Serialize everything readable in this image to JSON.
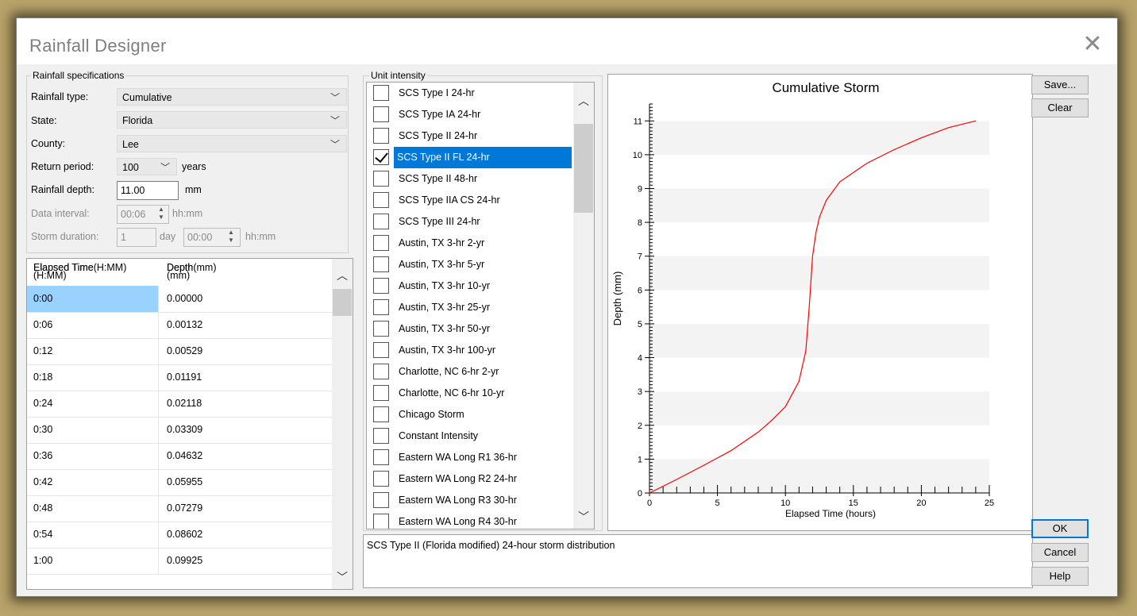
{
  "window": {
    "title": "Rainfall Designer",
    "close_glyph": "✕"
  },
  "specs": {
    "group_label": "Rainfall specifications",
    "rainfall_type_label": "Rainfall type:",
    "rainfall_type_value": "Cumulative",
    "state_label": "State:",
    "state_value": "Florida",
    "county_label": "County:",
    "county_value": "Lee",
    "return_period_label": "Return period:",
    "return_period_value": "100",
    "return_period_unit": "years",
    "rainfall_depth_label": "Rainfall depth:",
    "rainfall_depth_value": "11.00",
    "rainfall_depth_unit": "mm",
    "data_interval_label": "Data interval:",
    "data_interval_value": "00:06",
    "data_interval_unit": "hh:mm",
    "storm_duration_label": "Storm duration:",
    "storm_duration_days": "1",
    "storm_duration_days_unit": "day",
    "storm_duration_time": "00:00",
    "storm_duration_time_unit": "hh:mm"
  },
  "grid": {
    "col1": "Elapsed Time(H:MM)",
    "col1_overlap": "Elapsed Time (H:MM)",
    "col2": "Depth(mm)",
    "col2_overlap": "Depth (mm)",
    "rows": [
      {
        "time": "0:00",
        "depth": "0.00000"
      },
      {
        "time": "0:06",
        "depth": "0.00132"
      },
      {
        "time": "0:12",
        "depth": "0.00529"
      },
      {
        "time": "0:18",
        "depth": "0.01191"
      },
      {
        "time": "0:24",
        "depth": "0.02118"
      },
      {
        "time": "0:30",
        "depth": "0.03309"
      },
      {
        "time": "0:36",
        "depth": "0.04632"
      },
      {
        "time": "0:42",
        "depth": "0.05955"
      },
      {
        "time": "0:48",
        "depth": "0.07279"
      },
      {
        "time": "0:54",
        "depth": "0.08602"
      },
      {
        "time": "1:00",
        "depth": "0.09925"
      }
    ]
  },
  "unit_intensity": {
    "group_label": "Unit intensity",
    "items": [
      {
        "label": "SCS Type I 24-hr",
        "checked": false
      },
      {
        "label": "SCS Type IA 24-hr",
        "checked": false
      },
      {
        "label": "SCS Type II 24-hr",
        "checked": false
      },
      {
        "label": "SCS Type II FL 24-hr",
        "checked": true
      },
      {
        "label": "SCS Type II 48-hr",
        "checked": false
      },
      {
        "label": "SCS Type IIA CS 24-hr",
        "checked": false
      },
      {
        "label": "SCS Type III 24-hr",
        "checked": false
      },
      {
        "label": "Austin, TX 3-hr 2-yr",
        "checked": false
      },
      {
        "label": "Austin, TX 3-hr 5-yr",
        "checked": false
      },
      {
        "label": "Austin, TX 3-hr 10-yr",
        "checked": false
      },
      {
        "label": "Austin, TX 3-hr 25-yr",
        "checked": false
      },
      {
        "label": "Austin, TX 3-hr 50-yr",
        "checked": false
      },
      {
        "label": "Austin, TX 3-hr 100-yr",
        "checked": false
      },
      {
        "label": "Charlotte, NC 6-hr 2-yr",
        "checked": false
      },
      {
        "label": "Charlotte, NC 6-hr 10-yr",
        "checked": false
      },
      {
        "label": "Chicago Storm",
        "checked": false
      },
      {
        "label": "Constant Intensity",
        "checked": false
      },
      {
        "label": "Eastern WA Long R1 36-hr",
        "checked": false
      },
      {
        "label": "Eastern WA Long R2 24-hr",
        "checked": false
      },
      {
        "label": "Eastern WA Long R3 30-hr",
        "checked": false
      },
      {
        "label": "Eastern WA Long R4 30-hr",
        "checked": false
      }
    ],
    "description": "SCS Type II (Florida modified) 24-hour storm distribution"
  },
  "buttons": {
    "save": "Save...",
    "clear": "Clear",
    "ok": "OK",
    "cancel": "Cancel",
    "help": "Help"
  },
  "chart_data": {
    "type": "line",
    "title": "Cumulative Storm",
    "xlabel": "Elapsed Time (hours)",
    "ylabel": "Depth (mm)",
    "xlim": [
      0,
      25
    ],
    "ylim": [
      0,
      11.5
    ],
    "xticks": [
      0,
      5,
      10,
      15,
      20,
      25
    ],
    "yticks": [
      0,
      1,
      2,
      3,
      4,
      5,
      6,
      7,
      8,
      9,
      10,
      11
    ],
    "grid": "alternating horizontal bands",
    "series": [
      {
        "color": "#ff0000",
        "x": [
          0,
          2,
          4,
          6,
          8,
          9,
          10,
          11,
          11.5,
          11.75,
          12,
          12.25,
          12.5,
          13,
          14,
          16,
          18,
          20,
          22,
          24
        ],
        "y": [
          0,
          0.4,
          0.82,
          1.25,
          1.8,
          2.15,
          2.55,
          3.3,
          4.2,
          5.5,
          7.0,
          7.7,
          8.15,
          8.65,
          9.2,
          9.75,
          10.15,
          10.5,
          10.8,
          11.0
        ]
      }
    ]
  }
}
